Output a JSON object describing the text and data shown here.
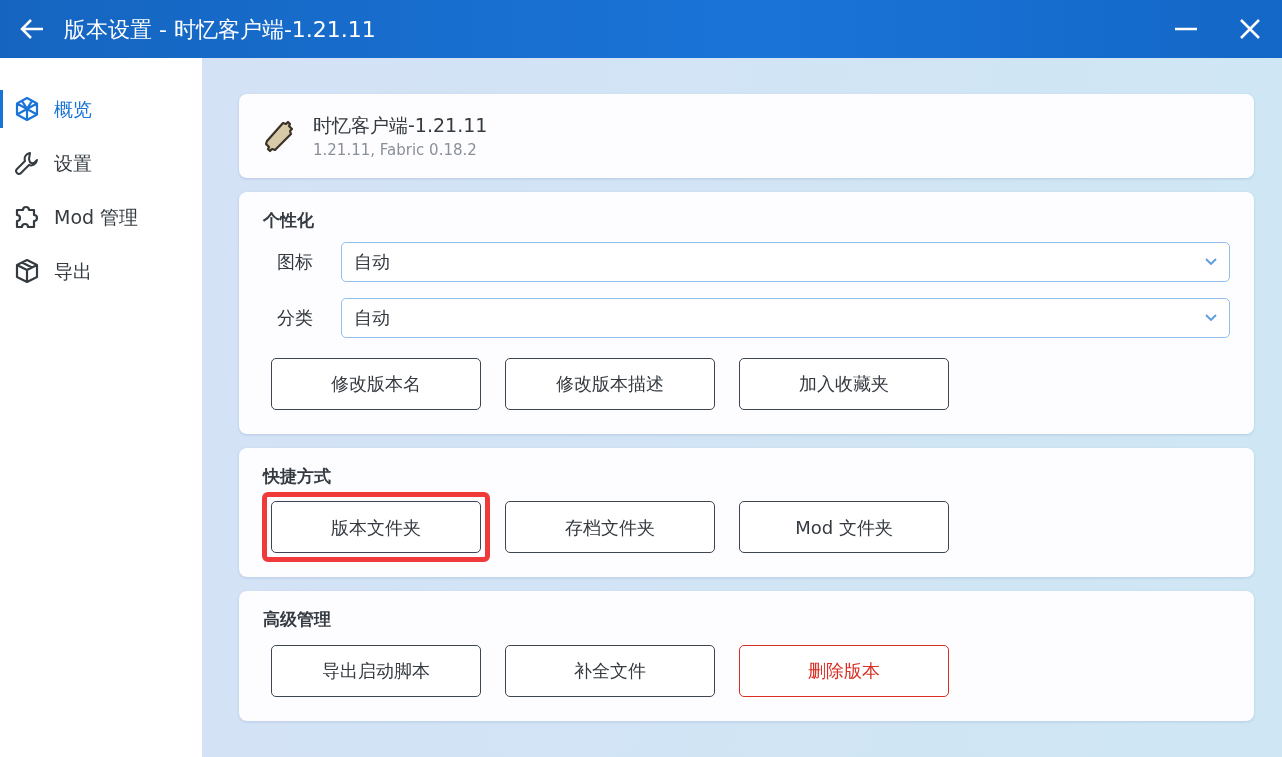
{
  "window": {
    "title": "版本设置 - 时忆客户端-1.21.11"
  },
  "sidebar": {
    "items": [
      {
        "label": "概览",
        "selected": true
      },
      {
        "label": "设置",
        "selected": false
      },
      {
        "label": "Mod 管理",
        "selected": false
      },
      {
        "label": "导出",
        "selected": false
      }
    ]
  },
  "version_card": {
    "name": "时忆客户端-1.21.11",
    "details": "1.21.11, Fabric 0.18.2"
  },
  "sections": [
    {
      "title": "个性化",
      "fields": [
        {
          "label": "图标",
          "value": "自动"
        },
        {
          "label": "分类",
          "value": "自动"
        }
      ],
      "buttons": [
        {
          "label": "修改版本名",
          "kind": "normal",
          "highlighted": false
        },
        {
          "label": "修改版本描述",
          "kind": "normal",
          "highlighted": false
        },
        {
          "label": "加入收藏夹",
          "kind": "normal",
          "highlighted": false
        }
      ]
    },
    {
      "title": "快捷方式",
      "buttons": [
        {
          "label": "版本文件夹",
          "kind": "normal",
          "highlighted": true
        },
        {
          "label": "存档文件夹",
          "kind": "normal",
          "highlighted": false
        },
        {
          "label": "Mod 文件夹",
          "kind": "normal",
          "highlighted": false
        }
      ]
    },
    {
      "title": "高级管理",
      "buttons": [
        {
          "label": "导出启动脚本",
          "kind": "normal",
          "highlighted": false
        },
        {
          "label": "补全文件",
          "kind": "normal",
          "highlighted": false
        },
        {
          "label": "删除版本",
          "kind": "danger",
          "highlighted": false
        }
      ]
    }
  ]
}
